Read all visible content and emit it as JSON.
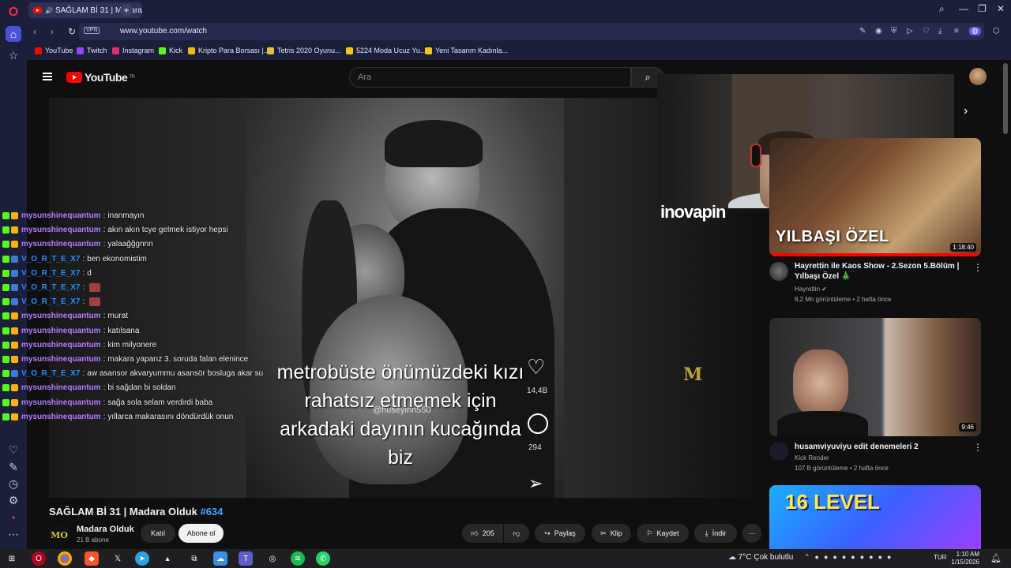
{
  "browser": {
    "tab_title": "SAĞLAM Bİ 31 | Madara",
    "url": "www.youtube.com/watch",
    "vpn_label": "VPN",
    "bookmarks": [
      {
        "label": "YouTube",
        "color": "#ff0000"
      },
      {
        "label": "Twitch",
        "color": "#9146ff"
      },
      {
        "label": "Instagram",
        "color": "#e1306c"
      },
      {
        "label": "Kick",
        "color": "#53fc18"
      },
      {
        "label": "Kripto Para Borsası |...",
        "color": "#f0b90b"
      },
      {
        "label": "Tetris 2020 Oyunu...",
        "color": "#e0c040"
      },
      {
        "label": "5224 Moda Ucuz Yu...",
        "color": "#f5c518"
      },
      {
        "label": "Yeni Tasarım Kadınla...",
        "color": "#f5c518"
      }
    ]
  },
  "youtube": {
    "logo_text": "YouTube",
    "logo_region": "TR",
    "search_placeholder": "Ara"
  },
  "video": {
    "caption": "metrobüste önümüzdeki kızı rahatsız etmemek için arkadaki dayının kucağında biz",
    "credit": "@huseyinn550",
    "likes_overlay": "14,4B",
    "comments_overlay": "294",
    "watermark": "M",
    "webcam_overlay_brand": "inovapin",
    "title": "SAĞLAM Bİ 31 | Madara Olduk",
    "title_tag": "#634"
  },
  "channel": {
    "logo": "MO",
    "name": "Madara Olduk",
    "subs": "21 B abone",
    "join_label": "Katıl",
    "subscribe_label": "Abone ol"
  },
  "actions": {
    "like_count": "205",
    "share": "Paylaş",
    "clip": "Klip",
    "save": "Kaydet",
    "download": "İndir"
  },
  "chat": [
    {
      "user": "mysunshinequantum",
      "msg": "inanmayın",
      "color": "#b57bff"
    },
    {
      "user": "mysunshinequantum",
      "msg": "akın akın tcye gelmek istiyor hepsi",
      "color": "#b57bff"
    },
    {
      "user": "mysunshinequantum",
      "msg": "yalaağğgnnn",
      "color": "#b57bff"
    },
    {
      "user": "V_O_R_T_E_X7",
      "msg": "ben ekonomistim",
      "color": "#1e90ff"
    },
    {
      "user": "V_O_R_T_E_X7",
      "msg": "d",
      "color": "#1e90ff"
    },
    {
      "user": "V_O_R_T_E_X7",
      "msg": "",
      "color": "#1e90ff"
    },
    {
      "user": "V_O_R_T_E_X7",
      "msg": "",
      "color": "#1e90ff"
    },
    {
      "user": "mysunshinequantum",
      "msg": "murat",
      "color": "#b57bff"
    },
    {
      "user": "mysunshinequantum",
      "msg": "katılsana",
      "color": "#b57bff"
    },
    {
      "user": "mysunshinequantum",
      "msg": "kim milyonere",
      "color": "#b57bff"
    },
    {
      "user": "mysunshinequantum",
      "msg": "makara yaparız 3. soruda falan elenince",
      "color": "#b57bff"
    },
    {
      "user": "V_O_R_T_E_X7",
      "msg": "aw asansor akvaryummu asansör bosluga akar su",
      "color": "#1e90ff"
    },
    {
      "user": "mysunshinequantum",
      "msg": "bi sağdan bi soldan",
      "color": "#b57bff"
    },
    {
      "user": "mysunshinequantum",
      "msg": "sağa sola selam verdirdi baba",
      "color": "#b57bff"
    },
    {
      "user": "mysunshinequantum",
      "msg": "yıllarca makarasını döndürdük onun",
      "color": "#b57bff"
    }
  ],
  "recommendations": [
    {
      "thumb_text": "YILBAŞI ÖZEL",
      "duration": "1:18:40",
      "title": "Hayrettin ile Kaos Show - 2.Sezon 5.Bölüm | Yılbaşı Özel 🎄",
      "channel": "Hayrettin ✔",
      "meta": "8,2 Mn görüntüleme • 2 hafta önce"
    },
    {
      "thumb_text": "",
      "duration": "9:46",
      "title": "husamviyuviyu edit denemeleri 2",
      "channel": "Kick Render",
      "meta": "107 B görüntüleme • 2 hafta önce"
    },
    {
      "thumb_text": "16 LEVEL"
    }
  ],
  "taskbar": {
    "weather": "7°C  Çok bulutlu",
    "lang": "TUR",
    "time": "1:10 AM",
    "date": "1/15/2026"
  }
}
